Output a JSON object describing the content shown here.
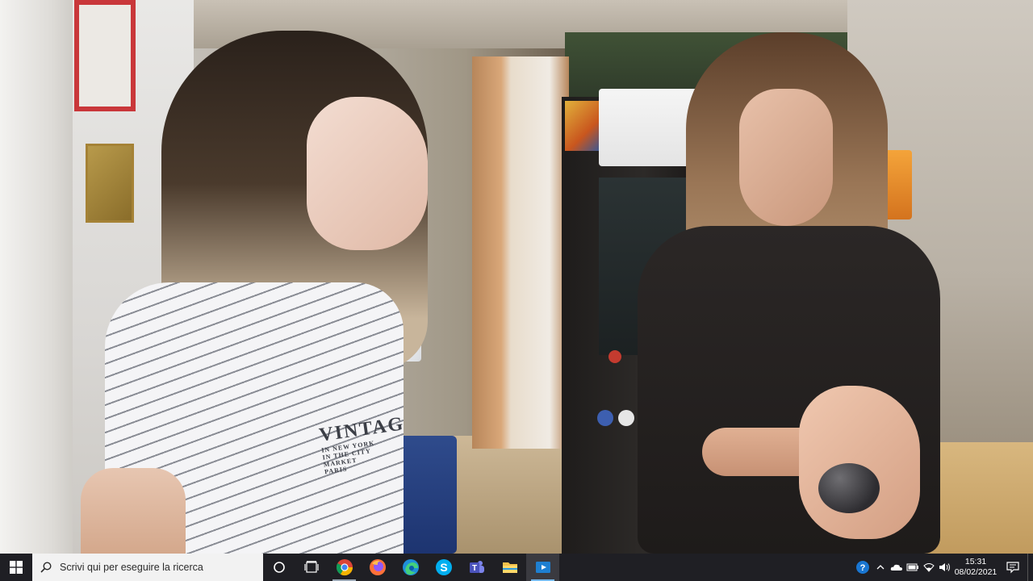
{
  "video_frame": {
    "description_colors": {
      "wall": "#d9d7d4",
      "arcade_cabinet": "#1e1c1b",
      "left_shirt": "#f4f4f6",
      "right_top": "#2b2726",
      "taskbar": "#1f1f24"
    },
    "shirt_print": {
      "line1": "VINTAG",
      "line2": "IN NEW YORK",
      "line3": "IN THE CITY",
      "line4": "MARKET",
      "line5": "PARIS"
    }
  },
  "taskbar": {
    "start_icon": "windows-logo-icon",
    "search_placeholder": "Scrivi qui per eseguire la ricerca",
    "search_icon": "search-icon",
    "cortana_icon": "cortana-circle-icon",
    "taskview_icon": "task-view-icon",
    "apps": [
      {
        "name": "chrome",
        "icon": "chrome-icon",
        "state": "running"
      },
      {
        "name": "firefox",
        "icon": "firefox-icon",
        "state": "idle"
      },
      {
        "name": "edge",
        "icon": "edge-icon",
        "state": "idle"
      },
      {
        "name": "skype",
        "icon": "skype-icon",
        "state": "idle"
      },
      {
        "name": "teams",
        "icon": "teams-icon",
        "state": "idle"
      },
      {
        "name": "file-explorer",
        "icon": "folder-icon",
        "state": "idle"
      },
      {
        "name": "media-player",
        "icon": "video-player-icon",
        "state": "active"
      }
    ],
    "tray": {
      "help_icon": "help-icon",
      "chevron_icon": "chevron-up-icon",
      "onedrive_icon": "cloud-icon",
      "battery_icon": "battery-icon",
      "network_icon": "wifi-icon",
      "volume_icon": "speaker-icon"
    },
    "clock": {
      "time": "15:31",
      "date": "08/02/2021"
    },
    "notifications_icon": "notification-center-icon"
  }
}
